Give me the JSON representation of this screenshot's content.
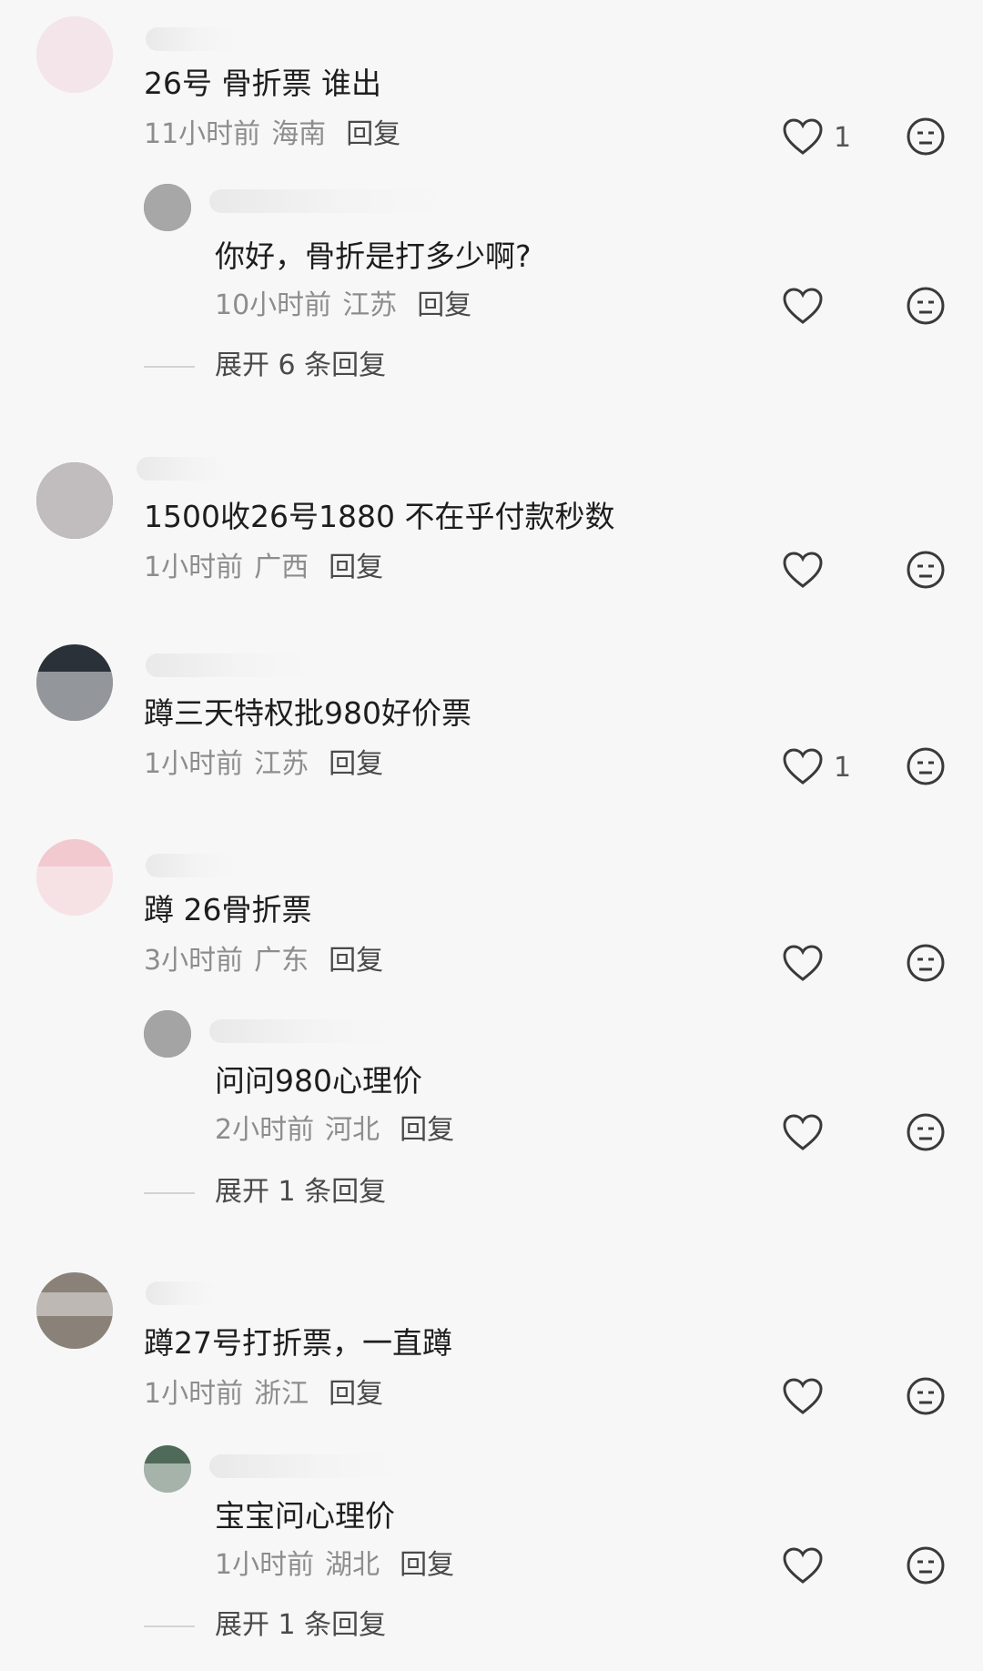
{
  "comments": [
    {
      "text": "26号 骨折票 谁出",
      "time": "11小时前",
      "location": "海南",
      "reply": "回复",
      "likes": "1",
      "replies": [
        {
          "text": "你好，骨折是打多少啊?",
          "time": "10小时前",
          "location": "江苏",
          "reply": "回复",
          "likes": ""
        }
      ],
      "expand": "展开 6 条回复"
    },
    {
      "text": "1500收26号1880 不在乎付款秒数",
      "time": "1小时前",
      "location": "广西",
      "reply": "回复",
      "likes": "",
      "replies": [],
      "expand": ""
    },
    {
      "text": "蹲三天特权批980好价票",
      "time": "1小时前",
      "location": "江苏",
      "reply": "回复",
      "likes": "1",
      "replies": [],
      "expand": ""
    },
    {
      "text": "蹲 26骨折票",
      "time": "3小时前",
      "location": "广东",
      "reply": "回复",
      "likes": "",
      "replies": [
        {
          "text": "问问980心理价",
          "time": "2小时前",
          "location": "河北",
          "reply": "回复",
          "likes": ""
        }
      ],
      "expand": "展开 1 条回复"
    },
    {
      "text": "蹲27号打折票，一直蹲",
      "time": "1小时前",
      "location": "浙江",
      "reply": "回复",
      "likes": "",
      "replies": [
        {
          "text": "宝宝问心理价",
          "time": "1小时前",
          "location": "湖北",
          "reply": "回复",
          "likes": ""
        }
      ],
      "expand": "展开 1 条回复"
    }
  ],
  "icons": {
    "like": "heart-outline-icon",
    "dislike": "neutral-face-icon"
  },
  "colors": {
    "background": "#f7f7f7",
    "text": "#1d1d1d",
    "meta": "#8d8d8d"
  }
}
